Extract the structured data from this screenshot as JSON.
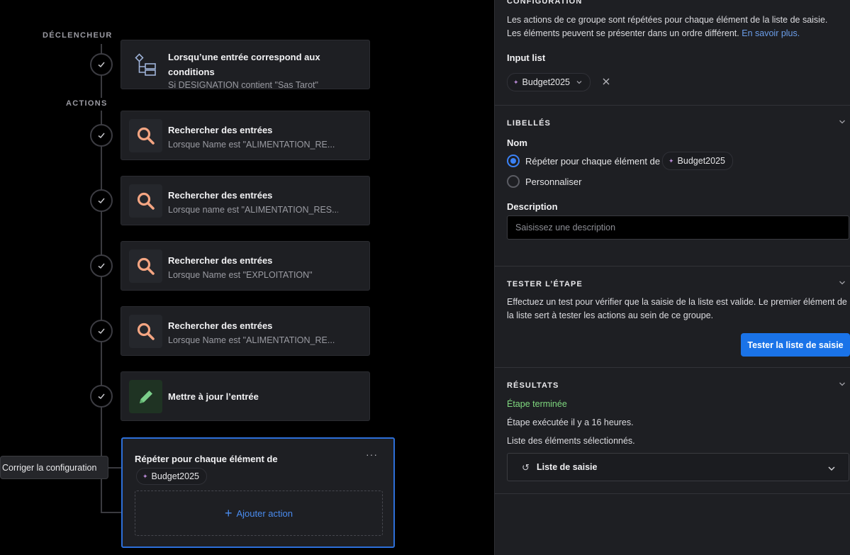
{
  "canvas": {
    "trigger_label": "DÉCLENCHEUR",
    "actions_label": "ACTIONS",
    "trigger": {
      "icon": "condition-flow-icon",
      "title": "Lorsqu’une entrée correspond aux conditions",
      "subtitle": "Si DESIGNATION contient \"Sas Tarot\""
    },
    "steps": [
      {
        "icon": "search-icon",
        "title": "Rechercher des entrées",
        "subtitle": "Lorsque Name est \"ALIMENTATION_RE..."
      },
      {
        "icon": "search-icon",
        "title": "Rechercher des entrées",
        "subtitle": "Lorsque name est \"ALIMENTATION_RES..."
      },
      {
        "icon": "search-icon",
        "title": "Rechercher des entrées",
        "subtitle": "Lorsque Name est \"EXPLOITATION\""
      },
      {
        "icon": "search-icon",
        "title": "Rechercher des entrées",
        "subtitle": "Lorsque Name est \"ALIMENTATION_RE..."
      },
      {
        "icon": "pencil-icon",
        "title": "Mettre à jour l’entrée",
        "subtitle": ""
      }
    ],
    "loop": {
      "title": "Répéter pour chaque élément de",
      "more": "···",
      "chip": "Budget2025",
      "add_action": "Ajouter action"
    },
    "tooltip": "Corriger la configuration",
    "colors": {
      "accent": "#2d6fd9",
      "search_icon": "#f4a582",
      "pencil_icon": "#7ccf8a"
    }
  },
  "panel": {
    "configuration": {
      "heading": "CONFIGURATION",
      "text_line1": "Les actions de ce groupe sont répétées pour chaque élément de la liste de saisie.",
      "text_line2": "Les éléments peuvent se présenter dans un ordre différent.",
      "learn_more": "En savoir plus.",
      "input_list_label": "Input list",
      "input_list_value": "Budget2025"
    },
    "labels": {
      "heading": "LIBELLÉS",
      "name_label": "Nom",
      "option_repeat": "Répéter pour chaque élément de",
      "option_repeat_chip": "Budget2025",
      "option_custom": "Personnaliser",
      "description_label": "Description",
      "description_placeholder": "Saisissez une description"
    },
    "test": {
      "heading": "TESTER L’ÉTAPE",
      "text": "Effectuez un test pour vérifier que la saisie de la liste est valide. Le premier élément de la liste sert à tester les actions au sein de ce groupe.",
      "button": "Tester la liste de saisie"
    },
    "results": {
      "heading": "RÉSULTATS",
      "status": "Étape terminée",
      "executed": "Étape exécutée il y a 16 heures.",
      "selected_list": "Liste des éléments sélectionnés.",
      "select_value": "Liste de saisie"
    }
  }
}
